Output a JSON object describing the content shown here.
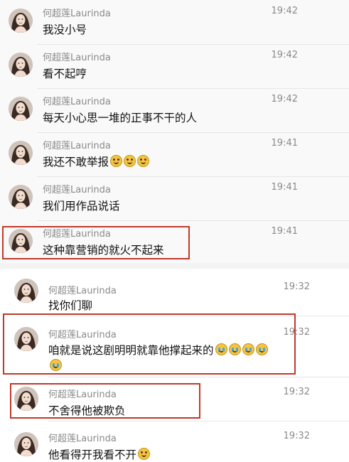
{
  "group1": {
    "messages": [
      {
        "name": "何超莲Laurinda",
        "time": "19:42",
        "text": "我没小号",
        "emoji_count": 0
      },
      {
        "name": "何超莲Laurinda",
        "time": "19:42",
        "text": "看不起哼",
        "emoji_count": 0
      },
      {
        "name": "何超莲Laurinda",
        "time": "19:42",
        "text": "每天小心思一堆的正事不干的人",
        "emoji_count": 0
      },
      {
        "name": "何超莲Laurinda",
        "time": "19:41",
        "text": "我还不敢举报",
        "emoji_count": 3
      },
      {
        "name": "何超莲Laurinda",
        "time": "19:41",
        "text": "我们用作品说话",
        "emoji_count": 0
      },
      {
        "name": "何超莲Laurinda",
        "time": "19:41",
        "text": "这种靠营销的就火不起来",
        "emoji_count": 0
      }
    ]
  },
  "group2": {
    "messages": [
      {
        "name": "何超莲Laurinda",
        "time": "19:32",
        "text": "找你们聊",
        "emoji_count": 0
      },
      {
        "name": "何超莲Laurinda",
        "time": "19:32",
        "text": "咱就是说这剧明明就靠他撑起来的",
        "emoji_count": 5
      },
      {
        "name": "何超莲Laurinda",
        "time": "19:32",
        "text": "不舍得他被欺负",
        "emoji_count": 0
      },
      {
        "name": "何超莲Laurinda",
        "time": "19:32",
        "text": "他看得开我看不开",
        "emoji_count": 1
      }
    ]
  },
  "colors": {
    "highlight": "#c0392b",
    "name": "#8a8a8a",
    "text": "#111111"
  }
}
